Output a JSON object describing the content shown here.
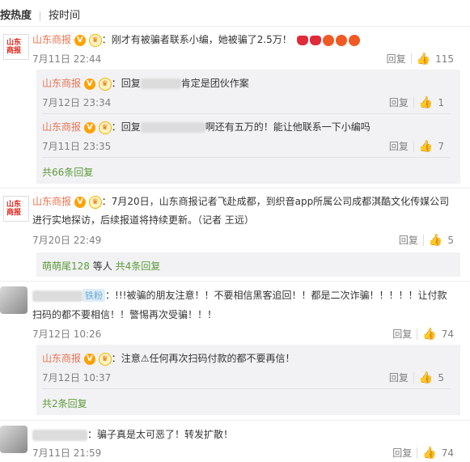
{
  "tabs": {
    "hot": "按热度",
    "time": "按时间"
  },
  "avatar_logo": "山东商报",
  "comments": [
    {
      "user": "山东商报",
      "text": "刚才有被骗者联系小编，她被骗了2.5万！",
      "time": "7月11日 22:44",
      "reply": "回复",
      "likes": "115",
      "replies": [
        {
          "user": "山东商报",
          "prefix": "回复",
          "text": "肯定是团伙作案",
          "time": "7月12日 23:34",
          "reply": "回复",
          "likes": "1"
        },
        {
          "user": "山东商报",
          "prefix": "回复",
          "text": "啊还有五万的！能让他联系一下小编吗",
          "time": "7月11日 23:35",
          "reply": "回复",
          "likes": "7"
        }
      ],
      "more": "共66条回复"
    },
    {
      "user": "山东商报",
      "text_line1": "7月20日，山东商报记者飞赴成都，到织音app所属公司成都淇酷文化传媒公司",
      "text_line2": "进行实地探访，后续报道将持续更新。（记者 王远）",
      "time": "7月20日 22:49",
      "reply": "回复",
      "likes": "5",
      "more_user": "萌萌尾128",
      "more_mid": "等人",
      "more": "共4条回复"
    },
    {
      "fans_badge": "铁粉",
      "text_line1": "!!!被骗的朋友注意！！不要相信黑客追回！！都是二次诈骗！！！！！让付款",
      "text_line2": "扫码的都不要相信！！警惕再次受骗！！！",
      "time": "7月12日 10:26",
      "reply": "回复",
      "likes": "74",
      "replies": [
        {
          "user": "山东商报",
          "text": "注意⚠任何再次扫码付款的都不要再信！",
          "time": "7月12日 10:37",
          "reply": "回复",
          "likes": "5"
        }
      ],
      "more": "共2条回复"
    },
    {
      "text": "骗子真是太可恶了！转发扩散！",
      "time": "7月11日 21:59",
      "reply": "回复",
      "likes": "74"
    }
  ],
  "colors": {
    "name": "#eb7350",
    "link": "#5d9b3a",
    "like_active": "#f15a24"
  }
}
